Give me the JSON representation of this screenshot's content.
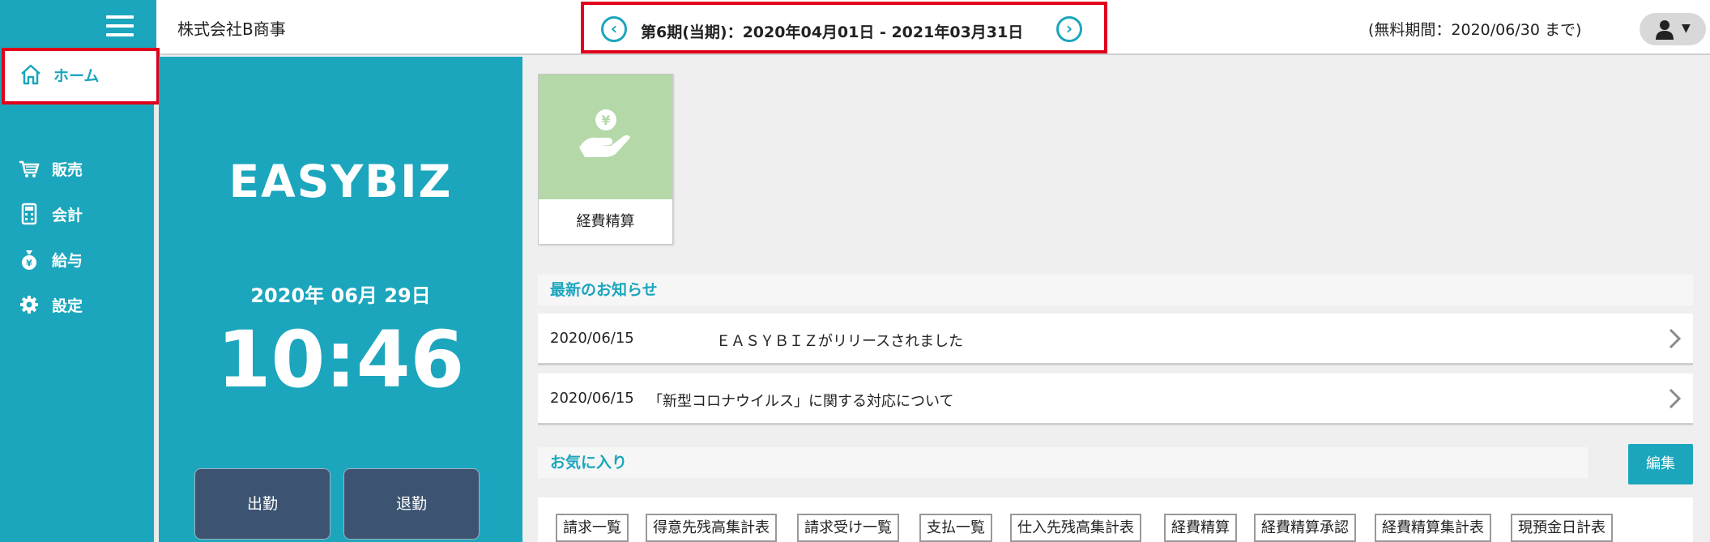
{
  "header": {
    "company": "株式会社B商事",
    "period": "第6期(当期)：2020年04月01日 - 2021年03月31日",
    "free_trial": "(無料期間：2020/06/30 まで)",
    "prev_arrow": "‹",
    "next_arrow": "›",
    "user_caret": "▼"
  },
  "sidebar": {
    "items": [
      {
        "label": "ホーム",
        "icon": "home-icon"
      },
      {
        "label": "販売",
        "icon": "cart-icon"
      },
      {
        "label": "会計",
        "icon": "calculator-icon"
      },
      {
        "label": "給与",
        "icon": "money-bag-icon"
      },
      {
        "label": "設定",
        "icon": "gear-icon"
      }
    ]
  },
  "clock": {
    "brand": "EASYBIZ",
    "date": "2020年 06月 29日",
    "time": "10:46",
    "clock_in": "出勤",
    "clock_out": "退勤"
  },
  "tile": {
    "label": "経費精算",
    "icon": "yen-hand-icon",
    "color": "#b4d8a8"
  },
  "news": {
    "heading": "最新のお知らせ",
    "items": [
      {
        "date": "2020/06/15",
        "title": "ＥＡＳＹＢＩＺがリリースされました"
      },
      {
        "date": "2020/06/15",
        "title": "「新型コロナウイルス」に関する対応について"
      }
    ]
  },
  "favorites": {
    "heading": "お気に入り",
    "edit": "編集",
    "items": [
      "請求一覧",
      "得意先残高集計表",
      "請求受け一覧",
      "支払一覧",
      "仕入先残高集計表",
      "経費精算",
      "経費精算承認",
      "経費精算集計表",
      "現預金日計表"
    ]
  },
  "colors": {
    "accent": "#1ba6bd",
    "highlight": "#e0001b",
    "clock_button": "#3c5472"
  }
}
